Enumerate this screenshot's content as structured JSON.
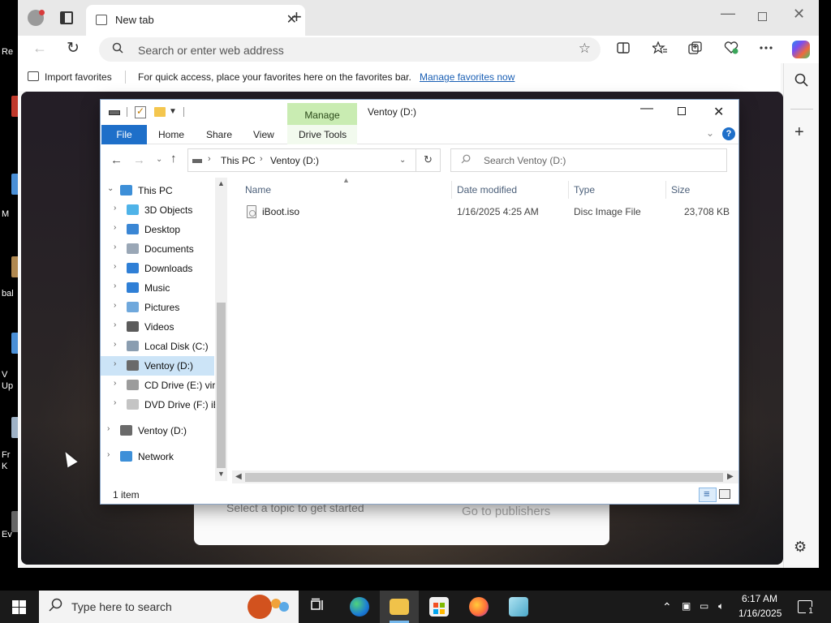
{
  "desktop": {
    "labels": [
      "Re",
      "M",
      "bal",
      "V",
      "Up",
      "Fr",
      "K",
      "Ev"
    ]
  },
  "browser": {
    "tab_title": "New tab",
    "tab_close": "✕",
    "new_tab": "+",
    "window_min": "—",
    "window_close": "✕",
    "back_icon": "←",
    "refresh_icon": "↻",
    "address_placeholder": "Search or enter web address",
    "favorite_icon": "☆",
    "toolbar_icons": [
      "split-screen-icon",
      "favorites-icon",
      "collections-icon",
      "browser-essentials-icon",
      "more-icon",
      "copilot-icon"
    ],
    "favbar": {
      "import": "Import favorites",
      "message": "For quick access, place your favorites here on the favorites bar.",
      "link": "Manage favorites now"
    },
    "content": {
      "topic_prompt": "Select a topic to get started",
      "publishers": "Go to publishers"
    }
  },
  "explorer": {
    "manage_tab": "Manage",
    "title": "Ventoy (D:)",
    "ribbon": {
      "file": "File",
      "tabs": [
        "Home",
        "Share",
        "View"
      ],
      "drive_tools": "Drive Tools",
      "help": "?"
    },
    "address": {
      "crumbs": [
        "This PC",
        "Ventoy (D:)"
      ],
      "search_placeholder": "Search Ventoy (D:)"
    },
    "nav": [
      {
        "label": "This PC",
        "icon": "pc-icon",
        "color": "#3d8fd8",
        "level": 0,
        "expanded": true
      },
      {
        "label": "3D Objects",
        "icon": "3d-objects-icon",
        "color": "#4fb3e8",
        "level": 1
      },
      {
        "label": "Desktop",
        "icon": "desktop-icon",
        "color": "#3a86d4",
        "level": 1
      },
      {
        "label": "Documents",
        "icon": "documents-icon",
        "color": "#9aa7b6",
        "level": 1
      },
      {
        "label": "Downloads",
        "icon": "downloads-icon",
        "color": "#2f7fd6",
        "level": 1
      },
      {
        "label": "Music",
        "icon": "music-icon",
        "color": "#2f7fd6",
        "level": 1
      },
      {
        "label": "Pictures",
        "icon": "pictures-icon",
        "color": "#6fa8dc",
        "level": 1
      },
      {
        "label": "Videos",
        "icon": "videos-icon",
        "color": "#5b5b5b",
        "level": 1
      },
      {
        "label": "Local Disk (C:)",
        "icon": "local-disk-icon",
        "color": "#8a9db0",
        "level": 1
      },
      {
        "label": "Ventoy (D:)",
        "icon": "drive-icon",
        "color": "#6a6a6a",
        "level": 1,
        "selected": true
      },
      {
        "label": "CD Drive (E:) virt",
        "icon": "cd-drive-icon",
        "color": "#9c9c9c",
        "level": 1
      },
      {
        "label": "DVD Drive (F:) iB",
        "icon": "dvd-drive-icon",
        "color": "#c4c4c4",
        "level": 1
      },
      {
        "label": "Ventoy (D:)",
        "icon": "drive-icon",
        "color": "#6a6a6a",
        "level": 0
      },
      {
        "label": "Network",
        "icon": "network-icon",
        "color": "#3d8fd8",
        "level": 0
      }
    ],
    "columns": [
      "Name",
      "Date modified",
      "Type",
      "Size"
    ],
    "files": [
      {
        "name": "iBoot.iso",
        "date": "1/16/2025 4:25 AM",
        "type": "Disc Image File",
        "size": "23,708 KB"
      }
    ],
    "status": "1 item"
  },
  "taskbar": {
    "search_placeholder": "Type here to search",
    "apps": [
      "task-view-icon",
      "edge-icon",
      "file-explorer-icon",
      "store-icon",
      "firefox-icon",
      "notepad-icon"
    ],
    "time": "6:17 AM",
    "date": "1/16/2025",
    "notification_count": "1"
  }
}
